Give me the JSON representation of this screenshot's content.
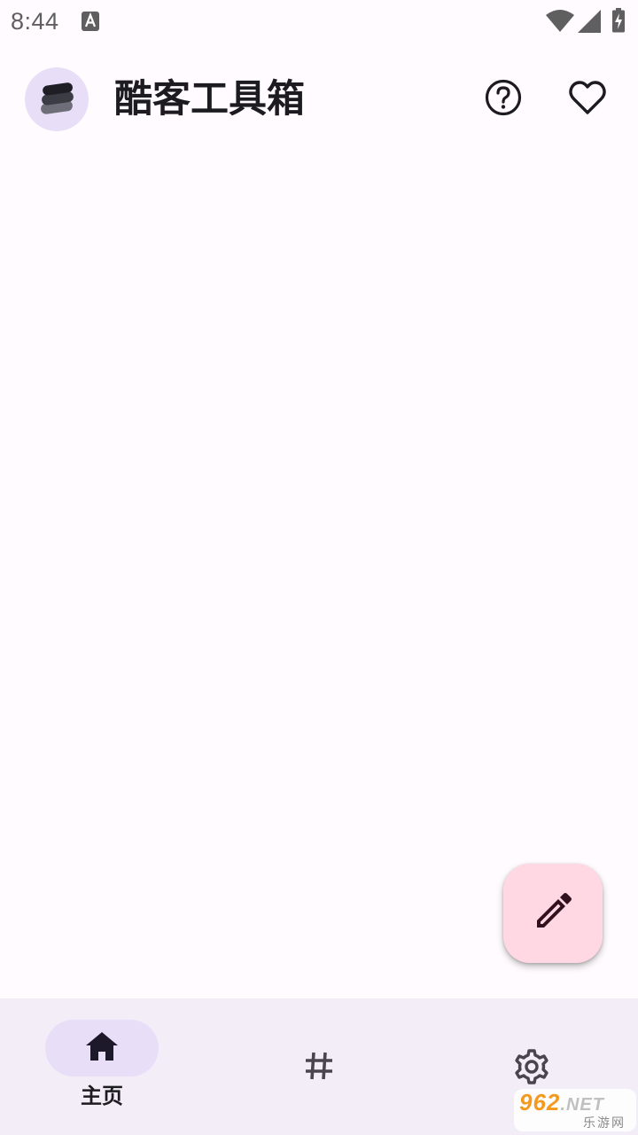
{
  "status_bar": {
    "time": "8:44",
    "icons": [
      "text-notification-icon",
      "wifi-icon",
      "signal-icon",
      "battery-charging-icon"
    ]
  },
  "app_bar": {
    "title": "酷客工具箱",
    "logo_icon": "layers-icon",
    "actions": [
      {
        "name": "help",
        "icon": "help-circle-icon"
      },
      {
        "name": "favorite",
        "icon": "heart-outline-icon"
      }
    ]
  },
  "fab": {
    "icon": "edit-pencil-icon"
  },
  "bottom_nav": {
    "items": [
      {
        "label": "主页",
        "icon": "home-icon",
        "selected": true
      },
      {
        "label": "",
        "icon": "hash-icon",
        "selected": false
      },
      {
        "label": "",
        "icon": "settings-gear-icon",
        "selected": false
      }
    ]
  },
  "watermark": {
    "brand": "962",
    "suffix": ".NET",
    "subtitle": "乐游网"
  },
  "colors": {
    "background": "#fffbfe",
    "nav_background": "#f3edf7",
    "indicator": "#e8def8",
    "fab": "#ffd8e4",
    "on_surface": "#1c1b1f"
  }
}
